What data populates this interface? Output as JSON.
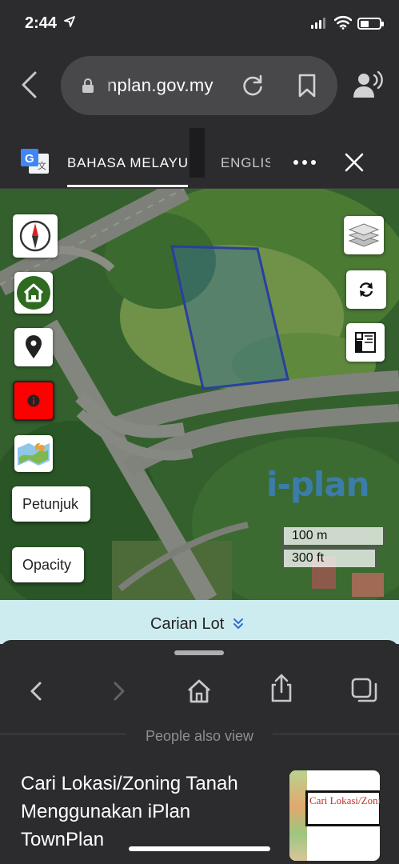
{
  "status_bar": {
    "time": "2:44",
    "icons": [
      "location-arrow-icon",
      "cellular-signal-icon",
      "wifi-icon",
      "battery-icon"
    ]
  },
  "browser": {
    "url": "nplan.gov.my",
    "icons": [
      "back-icon",
      "lock-icon",
      "reload-icon",
      "bookmark-icon",
      "reader-person-icon"
    ]
  },
  "translate_bar": {
    "tabs": [
      {
        "label": "BAHASA MELAYU",
        "active": true
      },
      {
        "label": "ENGLIS",
        "active": false
      }
    ],
    "icons": [
      "google-translate-icon",
      "more-icon",
      "close-icon"
    ]
  },
  "map": {
    "controls": [
      {
        "name": "compass-icon"
      },
      {
        "name": "home-icon"
      },
      {
        "name": "location-pin-icon"
      },
      {
        "name": "info-icon"
      },
      {
        "name": "map-layer-icon"
      }
    ],
    "right_controls": [
      {
        "name": "layers-icon"
      },
      {
        "name": "refresh-icon"
      },
      {
        "name": "measure-icon"
      }
    ],
    "petunjuk_label": "Petunjuk",
    "opacity_label": "Opacity",
    "scale_metric": "100 m",
    "scale_imperial": "300 ft",
    "watermark": "i-plan"
  },
  "search_lot": {
    "label": "Carian Lot"
  },
  "bottom_sheet": {
    "icons": [
      "sheet-back-icon",
      "sheet-forward-icon",
      "sheet-home-icon",
      "share-icon",
      "tabs-icon"
    ],
    "section_label": "People also view",
    "recommendation": {
      "title": "Cari Lokasi/Zoning Tanah Menggunakan iPlan TownPlan",
      "thumbnail_text": "Cari Lokasi/Zoning Tanah Menggunakan"
    }
  },
  "colors": {
    "browser_bg": "#2c2c2e",
    "url_pill": "#48484a",
    "search_lot_bg": "#cdecef",
    "plot_outline": "#2a3f9f",
    "info_button": "#ff0000",
    "home_button": "#2e6b1f"
  }
}
